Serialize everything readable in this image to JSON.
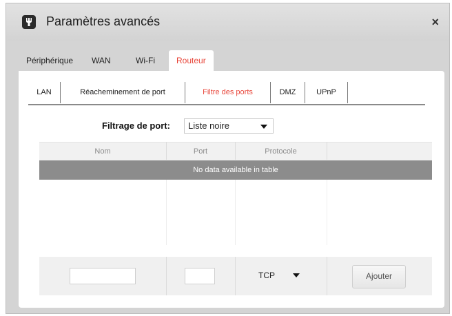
{
  "dialog": {
    "title": "Paramètres avancés",
    "app_icon": "wrench-icon",
    "close_label": "×"
  },
  "main_tabs": [
    {
      "label": "Périphérique",
      "active": false
    },
    {
      "label": "WAN",
      "active": false
    },
    {
      "label": "Wi-Fi",
      "active": false
    },
    {
      "label": "Routeur",
      "active": true
    }
  ],
  "sub_tabs": [
    {
      "label": "LAN",
      "active": false
    },
    {
      "label": "Réacheminement de port",
      "active": false
    },
    {
      "label": "Filtre des ports",
      "active": true
    },
    {
      "label": "DMZ",
      "active": false
    },
    {
      "label": "UPnP",
      "active": false
    }
  ],
  "filter": {
    "label": "Filtrage de port:",
    "selected": "Liste noire"
  },
  "table": {
    "columns": [
      "Nom",
      "Port",
      "Protocole"
    ],
    "empty_message": "No data available in table"
  },
  "add_row": {
    "name_value": "",
    "port_value": "",
    "protocol_selected": "TCP",
    "add_label": "Ajouter"
  },
  "colors": {
    "accent": "#e8463a",
    "empty_row": "#8c8c8c",
    "dialog_bg": "#d4d4d4"
  }
}
